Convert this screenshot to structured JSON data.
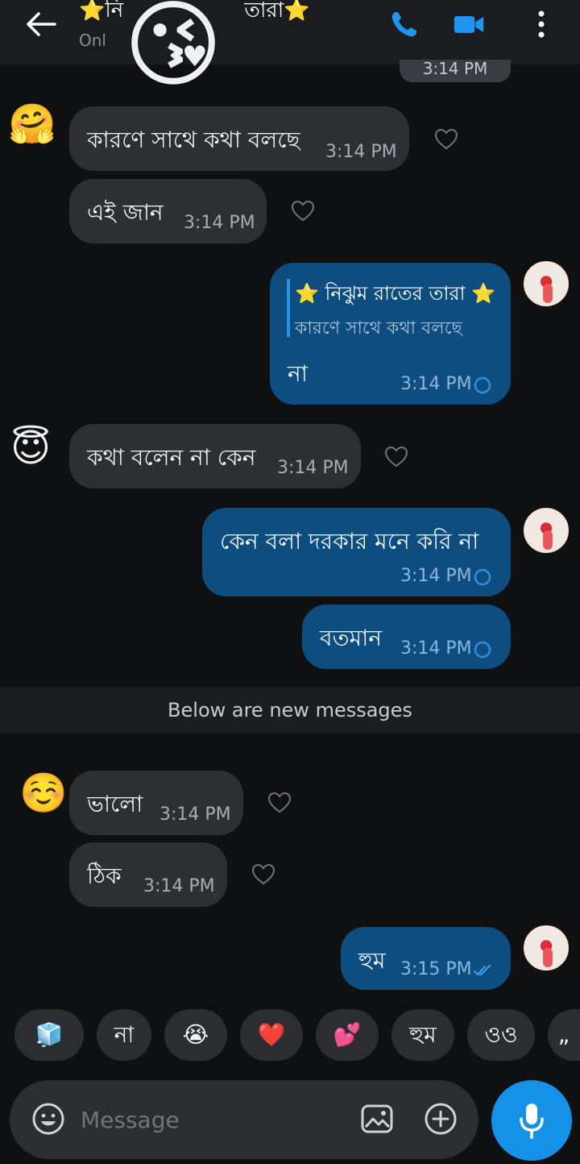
{
  "header": {
    "title_left": "⭐নি",
    "title_right": "তারা",
    "title_star_end": "⭐",
    "status": "Onl",
    "overlay_emoji": "😘",
    "icons": [
      "back-arrow-icon",
      "phone-icon",
      "video-call-icon",
      "more-options-icon"
    ]
  },
  "date_pill": "3:14 PM",
  "messages": [
    {
      "dir": "in",
      "text": "কারণে সাথে কথা বলছে",
      "time": "3:14 PM",
      "avatar": "🤗"
    },
    {
      "dir": "in",
      "text": "এই জান",
      "time": "3:14 PM"
    },
    {
      "dir": "out",
      "reply_name": "⭐ নিঝুম রাতের তারা ⭐",
      "reply_text": "কারণে সাথে কথা বলছে",
      "text": "না",
      "time": "3:14 PM"
    },
    {
      "dir": "in",
      "text": "কথা বলেন না কেন",
      "time": "3:14 PM",
      "avatar": "😇"
    },
    {
      "dir": "out",
      "text": "কেন বলা দরকার মনে করি না",
      "time": "3:14 PM"
    },
    {
      "dir": "out",
      "text": "বতমান",
      "time": "3:14 PM"
    },
    {
      "dir": "in",
      "text": "ভালো",
      "time": "3:14 PM",
      "avatar": "☺️"
    },
    {
      "dir": "in",
      "text": "ঠিক",
      "time": "3:14 PM"
    },
    {
      "dir": "out",
      "text": "হুম",
      "time": "3:15 PM"
    }
  ],
  "divider": "Below are new messages",
  "quick_replies": [
    "🧊",
    "না",
    "😭",
    "❤️",
    "💕",
    "হুম",
    "ওও",
    "„"
  ],
  "composer": {
    "placeholder": "Message",
    "icons": [
      "emoji-icon",
      "gallery-icon",
      "add-icon",
      "microphone-icon"
    ]
  },
  "colors": {
    "incoming_bubble": "#2d2f33",
    "outgoing_bubble": "#0d4d80",
    "accent": "#1691e8",
    "background": "#0f1012"
  }
}
